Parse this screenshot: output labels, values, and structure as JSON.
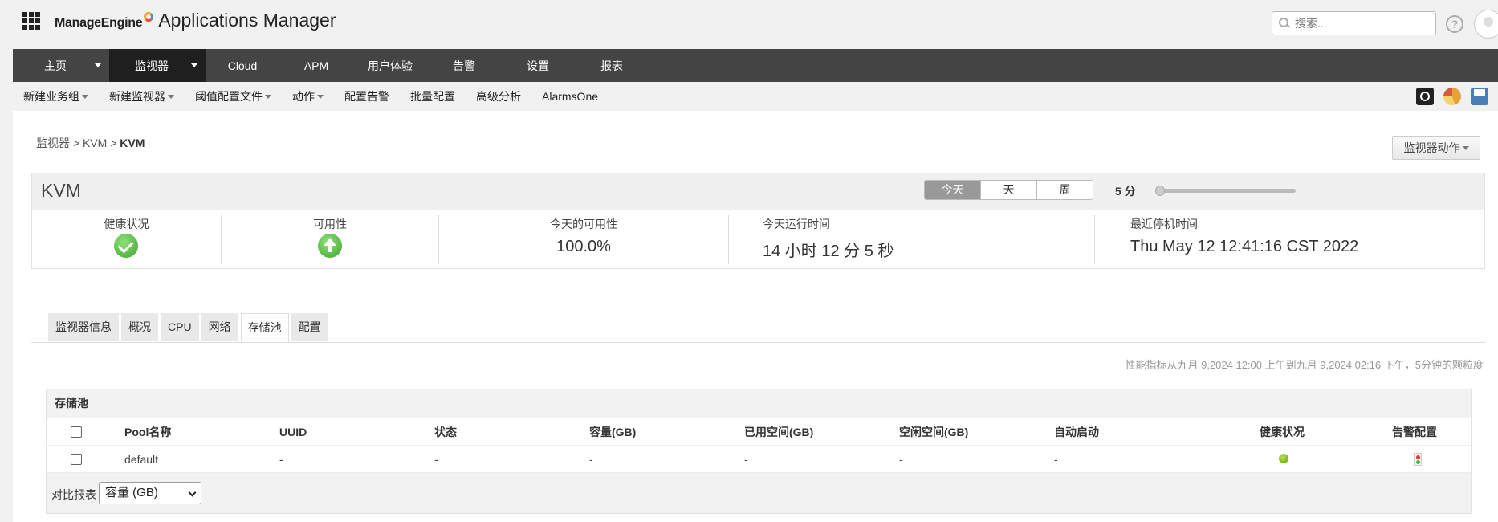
{
  "header": {
    "brand": "ManageEngine",
    "product": "Applications Manager",
    "search_placeholder": "搜索...",
    "help_symbol": "?"
  },
  "nav": {
    "items": [
      {
        "label": "主页",
        "dropdown": true,
        "active": false
      },
      {
        "label": "监视器",
        "dropdown": true,
        "active": true
      },
      {
        "label": "Cloud"
      },
      {
        "label": "APM"
      },
      {
        "label": "用户体验"
      },
      {
        "label": "告警"
      },
      {
        "label": "设置"
      },
      {
        "label": "报表"
      }
    ]
  },
  "subnav": {
    "items": [
      {
        "label": "新建业务组",
        "dropdown": true
      },
      {
        "label": "新建监视器",
        "dropdown": true
      },
      {
        "label": "阈值配置文件",
        "dropdown": true
      },
      {
        "label": "动作",
        "dropdown": true
      },
      {
        "label": "配置告警"
      },
      {
        "label": "批量配置"
      },
      {
        "label": "高级分析"
      },
      {
        "label": "AlarmsOne"
      }
    ],
    "tool_icons": [
      "camera-icon",
      "pie-chart-icon",
      "printer-icon"
    ]
  },
  "breadcrumb": {
    "part1": "监视器",
    "sep": ">",
    "part2": "KVM",
    "current": "KVM"
  },
  "monitor_actions_label": "监视器动作",
  "monitor": {
    "title": "KVM",
    "periods": [
      "今天",
      "天",
      "周"
    ],
    "selected_period": "今天",
    "poll_interval_label": "5 分",
    "slider_position": 0
  },
  "stats": {
    "health_label": "健康状况",
    "availability_label": "可用性",
    "today_availability_label": "今天的可用性",
    "today_availability_value": "100.0%",
    "uptime_label": "今天运行时间",
    "uptime_value": "14 小时 12 分 5 秒",
    "last_down_label": "最近停机时间",
    "last_down_value": "Thu May 12 12:41:16 CST 2022"
  },
  "tabs": [
    {
      "label": "监视器信息"
    },
    {
      "label": "概况"
    },
    {
      "label": "CPU"
    },
    {
      "label": "网络"
    },
    {
      "label": "存储池",
      "active": true
    },
    {
      "label": "配置"
    }
  ],
  "perf_note": "性能指标从九月 9,2024 12:00 上午到九月 9,2024 02:16 下午，5分钟的颗粒度",
  "pool": {
    "title": "存储池",
    "columns": [
      "Pool名称",
      "UUID",
      "状态",
      "容量(GB)",
      "已用空间(GB)",
      "空闲空间(GB)",
      "自动启动",
      "健康状况",
      "告警配置"
    ],
    "rows": [
      {
        "name": "default",
        "uuid": "-",
        "status": "-",
        "capacity": "-",
        "used": "-",
        "free": "-",
        "autostart": "-",
        "health": "ok"
      }
    ],
    "compare_label": "对比报表",
    "compare_selected": "容量 (GB)"
  }
}
